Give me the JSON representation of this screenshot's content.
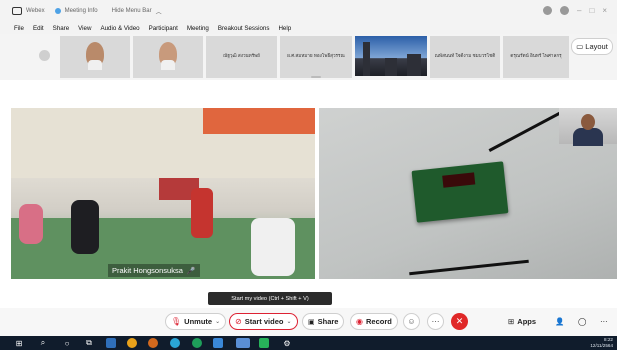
{
  "window": {
    "app_name": "Webex",
    "tabs": [
      "Meeting Info",
      "Hide Menu Bar"
    ]
  },
  "menu": [
    "File",
    "Edit",
    "Share",
    "View",
    "Audio & Video",
    "Participant",
    "Meeting",
    "Breakout Sessions",
    "Help"
  ],
  "participants": [
    {
      "name": ""
    },
    {
      "name": ""
    },
    {
      "name": "ณัฐวุฒิ สงวนทรัพย์"
    },
    {
      "name": "ผ.ศ.สมหมาย ทองโพธิ์สุวรรณ"
    },
    {
      "name": ""
    },
    {
      "name": "ณพัสนนท์ ใจดีงาม ชมบวรโชติ"
    },
    {
      "name": "ดรุณรัตน์ อินทร์ ไพศาลกรุ"
    }
  ],
  "layout_button": {
    "label": "Layout"
  },
  "main_video": {
    "speaker_label": "Prakit Hongsonsuksa"
  },
  "tooltip": "Start my video (Ctrl + Shift + V)",
  "controls": {
    "unmute": "Unmute",
    "start_video": "Start video",
    "share": "Share",
    "record": "Record",
    "apps": "Apps"
  },
  "taskbar": {
    "time": "8:22",
    "date": "12/11/2564"
  },
  "colors": {
    "end_button": "#e02828",
    "taskbar": "#101c2c",
    "mic_muted": "#d22233"
  }
}
